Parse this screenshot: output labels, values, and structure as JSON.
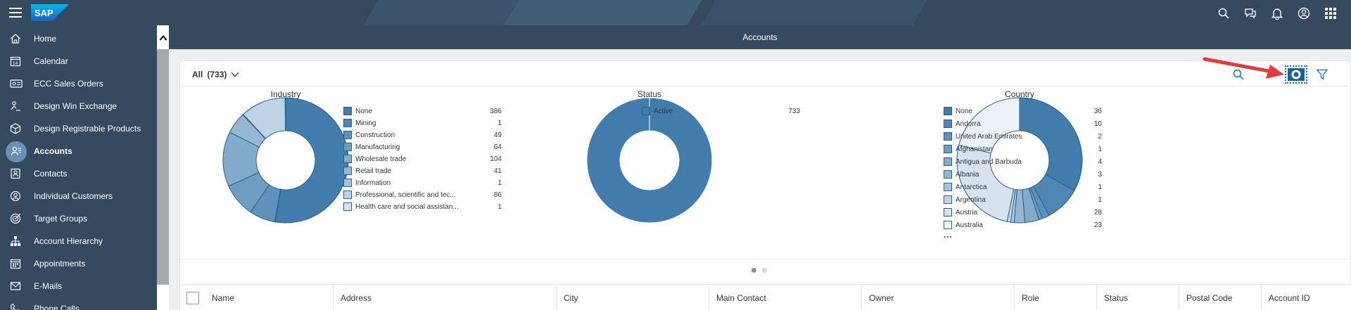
{
  "shell": {
    "logo_text": "SAP",
    "actions": [
      "search-icon",
      "feedback-icon",
      "notifications-icon",
      "user-icon",
      "apps-grid-icon"
    ]
  },
  "sidebar": {
    "items": [
      {
        "label": "Home",
        "icon": "home-icon"
      },
      {
        "label": "Calendar",
        "icon": "calendar-icon"
      },
      {
        "label": "ECC Sales Orders",
        "icon": "sales-order-icon"
      },
      {
        "label": "Design Win Exchange",
        "icon": "design-win-icon"
      },
      {
        "label": "Design Registrable Products",
        "icon": "product-icon"
      },
      {
        "label": "Accounts",
        "icon": "accounts-icon",
        "active": true
      },
      {
        "label": "Contacts",
        "icon": "contacts-icon"
      },
      {
        "label": "Individual Customers",
        "icon": "individual-customer-icon"
      },
      {
        "label": "Target Groups",
        "icon": "target-icon"
      },
      {
        "label": "Account Hierarchy",
        "icon": "hierarchy-icon"
      },
      {
        "label": "Appointments",
        "icon": "appointments-icon"
      },
      {
        "label": "E-Mails",
        "icon": "email-icon"
      },
      {
        "label": "Phone Calls",
        "icon": "phone-icon"
      }
    ]
  },
  "page": {
    "title": "Accounts"
  },
  "filter": {
    "label": "All",
    "count": "(733)"
  },
  "colors": {
    "shell": "#354a5f",
    "accent": "#0a6ed1",
    "chart_primary": "#427cac",
    "arrow": "#e23c3c"
  },
  "chart_data": [
    {
      "type": "pie",
      "title": "Industry",
      "categories": [
        "None",
        "Mining",
        "Construction",
        "Manufacturing",
        "Wholesale trade",
        "Retail trade",
        "Information",
        "Professional, scientific and tec...",
        "Health care and social assistan..."
      ],
      "values": [
        386,
        1,
        49,
        64,
        104,
        41,
        1,
        86,
        1
      ],
      "legend": "right"
    },
    {
      "type": "pie",
      "title": "Status",
      "categories": [
        "Active"
      ],
      "values": [
        733
      ],
      "legend": "right"
    },
    {
      "type": "pie",
      "title": "Country",
      "categories": [
        "None",
        "Andorra",
        "United Arab Emirates",
        "Afghanistan",
        "Antigua and Barbuda",
        "Albania",
        "Antarctica",
        "Argentina",
        "Austria",
        "Australia"
      ],
      "values": [
        36,
        10,
        2,
        1,
        4,
        3,
        1,
        1,
        28,
        23
      ],
      "more_indicator": "...",
      "legend": "right"
    }
  ],
  "table": {
    "columns": [
      "Name",
      "Address",
      "City",
      "Main Contact",
      "Owner",
      "Role",
      "Status",
      "Postal Code",
      "Account ID"
    ]
  }
}
